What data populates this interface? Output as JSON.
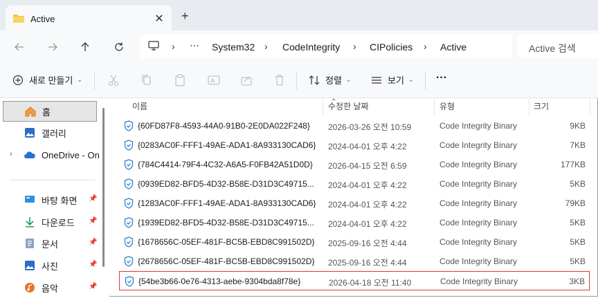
{
  "tab": {
    "title": "Active",
    "close": "✕",
    "new_tab": "+"
  },
  "breadcrumb": {
    "more": "···",
    "items": [
      "System32",
      "CodeIntegrity",
      "CIPolicies",
      "Active"
    ]
  },
  "search": {
    "placeholder": "Active 검색"
  },
  "toolbar": {
    "new_label": "새로 만들기",
    "sort_label": "정렬",
    "view_label": "보기",
    "more_label": "···"
  },
  "sidebar": {
    "items": [
      {
        "label": "홈"
      },
      {
        "label": "갤러리"
      },
      {
        "label": "OneDrive - OnM"
      },
      {
        "label": "바탕 화면"
      },
      {
        "label": "다운로드"
      },
      {
        "label": "문서"
      },
      {
        "label": "사진"
      },
      {
        "label": "음악"
      }
    ]
  },
  "columns": {
    "name": "이름",
    "date": "수정한 날짜",
    "type": "유형",
    "size": "크기"
  },
  "files": [
    {
      "name": "{60FD87F8-4593-44A0-91B0-2E0DA022F248}",
      "date": "2026-03-26 오전 10:59",
      "type": "Code Integrity Binary",
      "size": "9KB"
    },
    {
      "name": "{0283AC0F-FFF1-49AE-ADA1-8A933130CAD6}",
      "date": "2024-04-01 오후 4:22",
      "type": "Code Integrity Binary",
      "size": "7KB"
    },
    {
      "name": "{784C4414-79F4-4C32-A6A5-F0FB42A51D0D}",
      "date": "2026-04-15 오전 6:59",
      "type": "Code Integrity Binary",
      "size": "177KB"
    },
    {
      "name": "{0939ED82-BFD5-4D32-B58E-D31D3C49715...",
      "date": "2024-04-01 오후 4:22",
      "type": "Code Integrity Binary",
      "size": "5KB"
    },
    {
      "name": "{1283AC0F-FFF1-49AE-ADA1-8A933130CAD6}",
      "date": "2024-04-01 오후 4:22",
      "type": "Code Integrity Binary",
      "size": "79KB"
    },
    {
      "name": "{1939ED82-BFD5-4D32-B58E-D31D3C49715...",
      "date": "2024-04-01 오후 4:22",
      "type": "Code Integrity Binary",
      "size": "5KB"
    },
    {
      "name": "{1678656C-05EF-481F-BC5B-EBD8C991502D}",
      "date": "2025-09-16 오전 4:44",
      "type": "Code Integrity Binary",
      "size": "5KB"
    },
    {
      "name": "{2678656C-05EF-481F-BC5B-EBD8C991502D}",
      "date": "2025-09-16 오전 4:44",
      "type": "Code Integrity Binary",
      "size": "5KB"
    },
    {
      "name": "{54be3b66-0e76-4313-aebe-9304bda8f78e}",
      "date": "2026-04-18 오전 11:40",
      "type": "Code Integrity Binary",
      "size": "3KB"
    }
  ],
  "colors": {
    "highlight_border": "#d9383a",
    "shield": "#2f80d1",
    "folder": "#f4c542"
  }
}
